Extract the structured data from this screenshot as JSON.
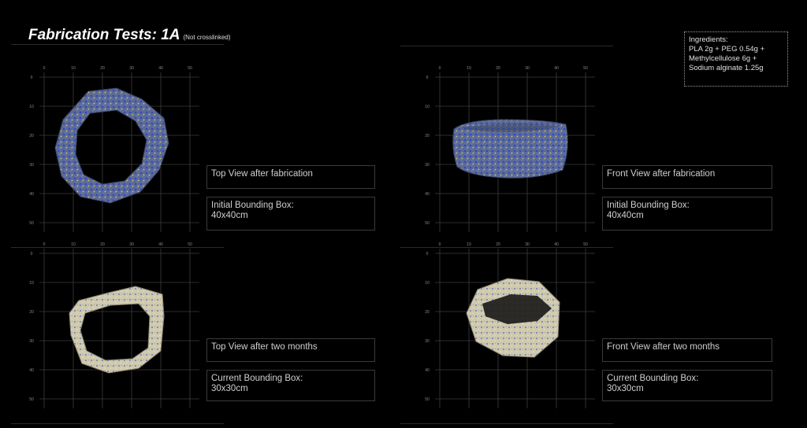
{
  "header": {
    "title": "Fabrication Tests: 1A",
    "subtitle": "(Not crosslinked)"
  },
  "ingredients": {
    "lines": [
      "Ingredients:",
      "PLA 2g + PEG 0.54g +",
      "Methylcellulose 6g +",
      "Sodium alginate 1.25g"
    ]
  },
  "grid": {
    "x_ticks": [
      "0",
      "10",
      "20",
      "30",
      "40",
      "50"
    ],
    "y_ticks": [
      "0",
      "10",
      "20",
      "30",
      "40",
      "50"
    ]
  },
  "panels": [
    {
      "view_label": "Top View after fabrication",
      "bbox_line1": "Initial Bounding Box:",
      "bbox_line2": "40x40cm"
    },
    {
      "view_label": "Front View after fabrication",
      "bbox_line1": "Initial Bounding Box:",
      "bbox_line2": "40x40cm"
    },
    {
      "view_label": "Top View after two months",
      "bbox_line1": "Current Bounding Box:",
      "bbox_line2": "30x30cm"
    },
    {
      "view_label": "Front View after two months",
      "bbox_line1": "Current Bounding Box:",
      "bbox_line2": "30x30cm"
    }
  ],
  "colors": {
    "blue_sample": "#5a6a9c",
    "blue_speckle": "#2b46c8",
    "yellow_speckle": "#c9c46a",
    "aged_sample": "#cfc9ad"
  }
}
